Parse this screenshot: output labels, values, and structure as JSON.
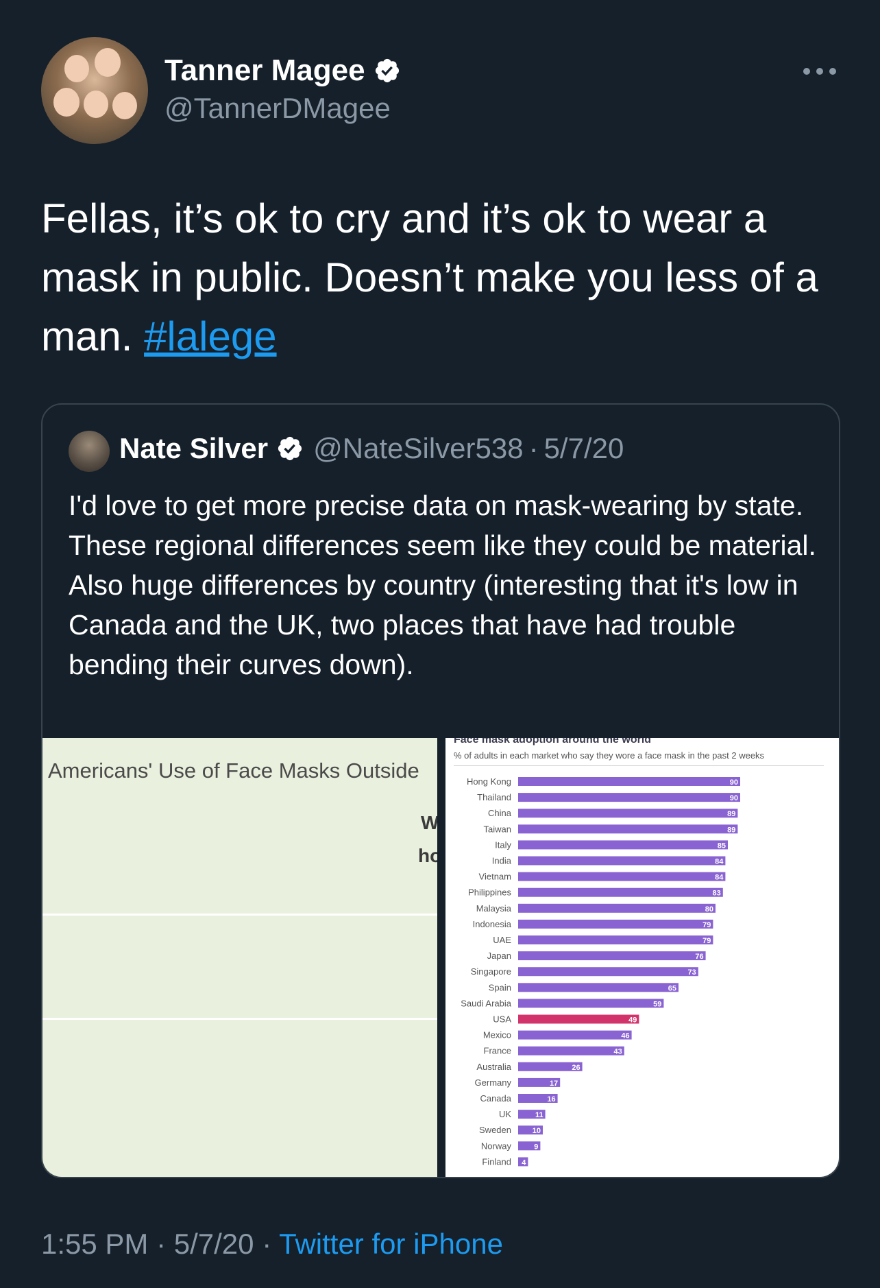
{
  "author": {
    "name": "Tanner Magee",
    "handle": "@TannerDMagee"
  },
  "tweet": {
    "text_before": "Fellas, it’s ok to cry and it’s ok to wear a mask in public.  Doesn’t make you less of a man. ",
    "hashtag": "#lalege"
  },
  "quote": {
    "name": "Nate Silver",
    "handle": "@NateSilver538",
    "sep": "·",
    "date": "5/7/20",
    "text": "I'd love to get more precise data on mask-wearing by state. These regional differences seem like they could be material. Also huge differences by country (interesting that it's low in Canada and the UK, two places that have had trouble bending their curves down).",
    "left_image": {
      "title": "Americans' Use of Face Masks Outside",
      "fragment_1": "W",
      "fragment_2": "ho"
    }
  },
  "footer": {
    "time": "1:55 PM",
    "sep1": " · ",
    "date": "5/7/20",
    "sep2": " · ",
    "source": "Twitter for iPhone"
  },
  "colors": {
    "background": "#15202b",
    "accent": "#1d9bf0",
    "bar": "#8a63d2",
    "highlight_bar": "#d2336b"
  },
  "chart_data": {
    "type": "bar",
    "orientation": "horizontal",
    "title": "Face mask adoption around the world",
    "subtitle": "% of adults in each market who say they wore a face mask in the past 2 weeks",
    "categories": [
      "Hong Kong",
      "Thailand",
      "China",
      "Taiwan",
      "Italy",
      "India",
      "Vietnam",
      "Philippines",
      "Malaysia",
      "Indonesia",
      "UAE",
      "Japan",
      "Singapore",
      "Spain",
      "Saudi Arabia",
      "USA",
      "Mexico",
      "France",
      "Australia",
      "Germany",
      "Canada",
      "UK",
      "Sweden",
      "Norway",
      "Finland"
    ],
    "values": [
      90,
      90,
      89,
      89,
      85,
      84,
      84,
      83,
      80,
      79,
      79,
      76,
      73,
      65,
      59,
      49,
      46,
      43,
      26,
      17,
      16,
      11,
      10,
      9,
      4
    ],
    "highlight": "USA",
    "xlim": [
      0,
      100
    ]
  }
}
